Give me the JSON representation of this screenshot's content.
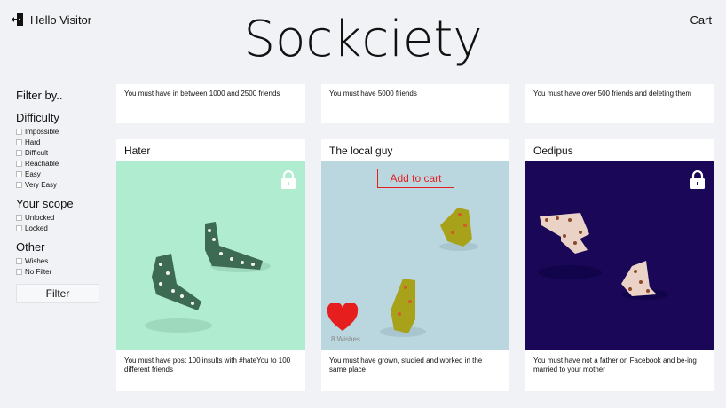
{
  "header": {
    "greeting": "Hello Visitor",
    "logo": "Sockciety",
    "cart": "Cart"
  },
  "sidebar": {
    "title": "Filter by..",
    "groups": [
      {
        "title": "Difficulty",
        "options": [
          "Impossible",
          "Hard",
          "Difficult",
          "Reachable",
          "Easy",
          "Very Easy"
        ]
      },
      {
        "title": "Your scope",
        "options": [
          "Unlocked",
          "Locked"
        ]
      },
      {
        "title": "Other",
        "options": [
          "Wishes",
          "No Filter"
        ]
      }
    ],
    "filter_button": "Filter"
  },
  "top_cards": [
    {
      "desc": "You must have in between 1000 and 2500 friends"
    },
    {
      "desc": "You must have 5000 friends"
    },
    {
      "desc": "You must have over 500 friends and deleting them"
    }
  ],
  "cards": [
    {
      "title": "Hater",
      "desc": "You must have post 100 insults with #hateYou to 100 different friends",
      "bg": "#b0eccf",
      "locked": true
    },
    {
      "title": "The local guy",
      "desc": "You must have grown, studied and worked in the same place",
      "bg": "#bad7e0",
      "add_to_cart": "Add to cart",
      "wishes": "8 Wishes"
    },
    {
      "title": "Oedipus",
      "desc": "You must have not a father on Facebook and be-ing married to your mother",
      "bg": "#1a0758",
      "locked": true
    }
  ],
  "colors": {
    "accent": "#e61e1e",
    "background": "#f1f2f5"
  }
}
